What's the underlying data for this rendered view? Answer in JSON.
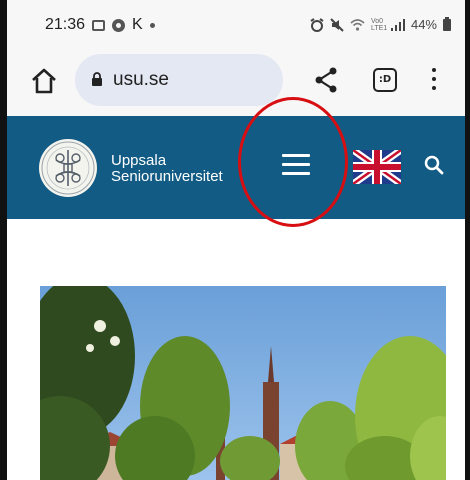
{
  "status_bar": {
    "time": "21:36",
    "letter": "K",
    "battery": "44%",
    "signal_label": "Vo0 LTE1"
  },
  "browser": {
    "url": "usu.se",
    "tab_label": ":D"
  },
  "site_header": {
    "brand_line1": "Uppsala",
    "brand_line2": "Senioruniversitet",
    "background_color": "#115b84"
  },
  "annotation": {
    "color": "#d80f12"
  }
}
